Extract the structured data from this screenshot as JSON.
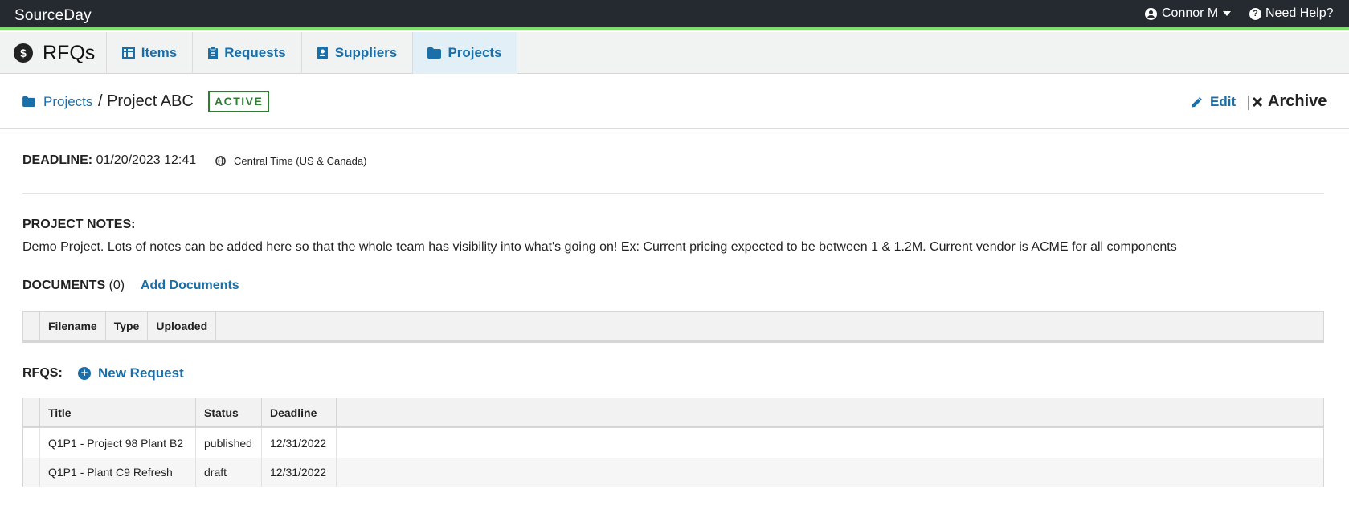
{
  "app": {
    "brand": "SourceDay",
    "module_title": "RFQs",
    "module_icon": "$"
  },
  "topbar": {
    "user_name": "Connor M",
    "help_label": "Need Help?"
  },
  "nav": {
    "tabs": [
      {
        "label": "Items",
        "icon": "table-icon"
      },
      {
        "label": "Requests",
        "icon": "clipboard-icon"
      },
      {
        "label": "Suppliers",
        "icon": "contact-book-icon"
      },
      {
        "label": "Projects",
        "icon": "folder-icon",
        "active": true
      }
    ]
  },
  "header": {
    "breadcrumb_link": "Projects",
    "breadcrumb_sep": "/",
    "project_name": "Project ABC",
    "status": "ACTIVE",
    "edit_label": "Edit",
    "archive_label": "Archive"
  },
  "deadline": {
    "label": "DEADLINE:",
    "value": "01/20/2023 12:41",
    "timezone": "Central Time (US & Canada)"
  },
  "notes": {
    "label": "PROJECT NOTES:",
    "text": "Demo Project. Lots of notes can be added here so that the whole team has visibility into what's going on! Ex: Current pricing expected to be between 1 & 1.2M. Current vendor is ACME for all components"
  },
  "documents": {
    "label": "DOCUMENTS",
    "count": "(0)",
    "add_label": "Add Documents",
    "columns": [
      "Filename",
      "Type",
      "Uploaded"
    ]
  },
  "rfqs": {
    "label": "RFQS:",
    "new_label": "New Request",
    "columns": [
      "Title",
      "Status",
      "Deadline"
    ],
    "rows": [
      {
        "title": "Q1P1 - Project 98 Plant B2",
        "status": "published",
        "deadline": "12/31/2022"
      },
      {
        "title": "Q1P1 - Plant C9 Refresh",
        "status": "draft",
        "deadline": "12/31/2022"
      }
    ]
  },
  "colors": {
    "topbar": "#252a31",
    "accent_green": "#7fdc6a",
    "link": "#1a6fa8",
    "badge": "#2e7d32"
  }
}
